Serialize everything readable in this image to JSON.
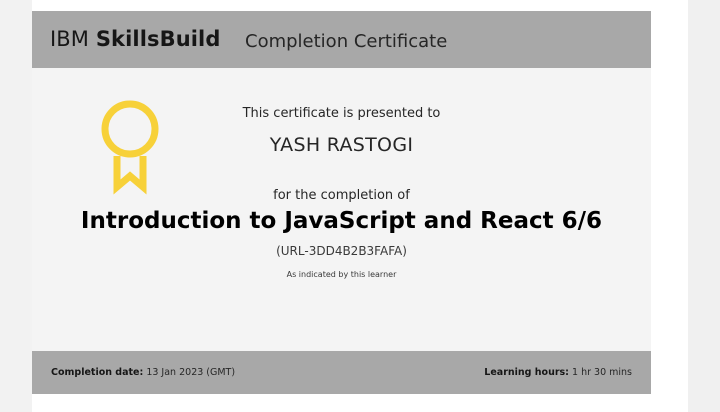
{
  "certificate": {
    "header": {
      "brand_prefix": "IBM",
      "brand_name": "SkillsBuild",
      "title": "Completion Certificate"
    },
    "icon": "ribbon-award-icon",
    "accent_color": "#f7d139",
    "presented_to_label": "This certificate is presented to",
    "learner_name": "YASH RASTOGI",
    "completion_label": "for the completion of",
    "course_title": "Introduction to JavaScript and React 6/6",
    "course_id": "(URL-3DD4B2B3FAFA)",
    "note": "As indicated by this learner",
    "footer": {
      "completion_date_label": "Completion date:",
      "completion_date_value": "13 Jan 2023 (GMT)",
      "learning_hours_label": "Learning hours:",
      "learning_hours_value": "1 hr 30 mins"
    }
  }
}
